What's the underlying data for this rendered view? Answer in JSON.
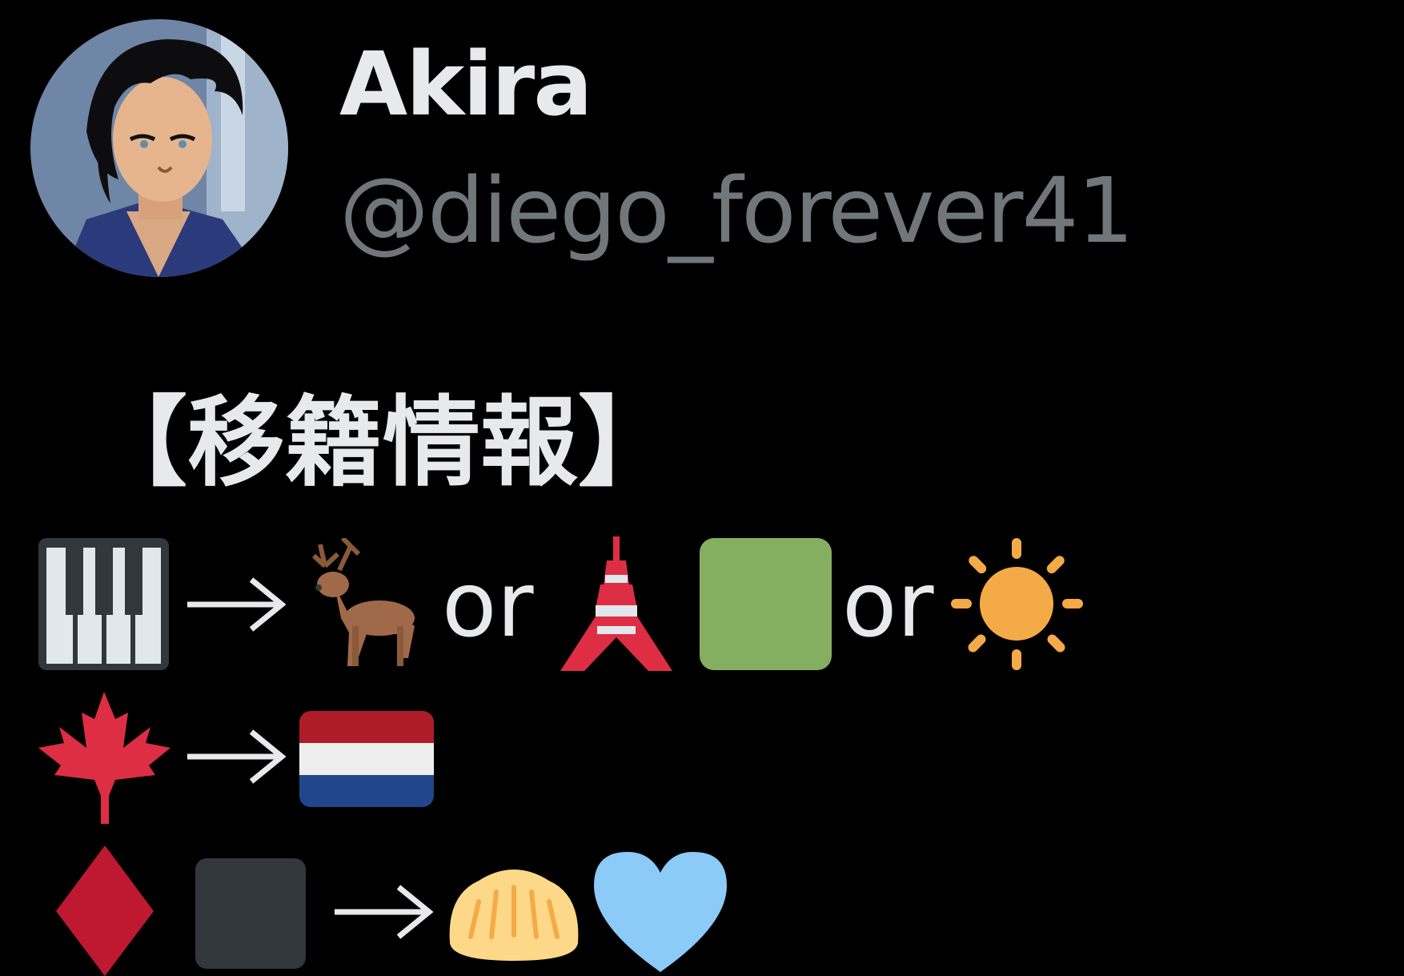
{
  "profile": {
    "display_name": "Akira",
    "handle": "@diego_forever41"
  },
  "post": {
    "heading": "【移籍情報】",
    "lines": [
      {
        "items": [
          "piano-icon",
          "arrow-icon",
          "deer-icon",
          "or",
          "tokyo-tower-icon",
          "green-square-icon",
          "or",
          "sun-icon"
        ],
        "connector_1": "or",
        "connector_2": "or"
      },
      {
        "items": [
          "maple-leaf-icon",
          "arrow-icon",
          "netherlands-flag-icon"
        ]
      },
      {
        "items": [
          "red-diamond-icon",
          "black-square-icon",
          "arrow-icon",
          "dumpling-icon",
          "blue-heart-icon"
        ]
      }
    ]
  },
  "colors": {
    "background": "#000000",
    "primary_text": "#e7e9ea",
    "secondary_text": "#71767b"
  }
}
